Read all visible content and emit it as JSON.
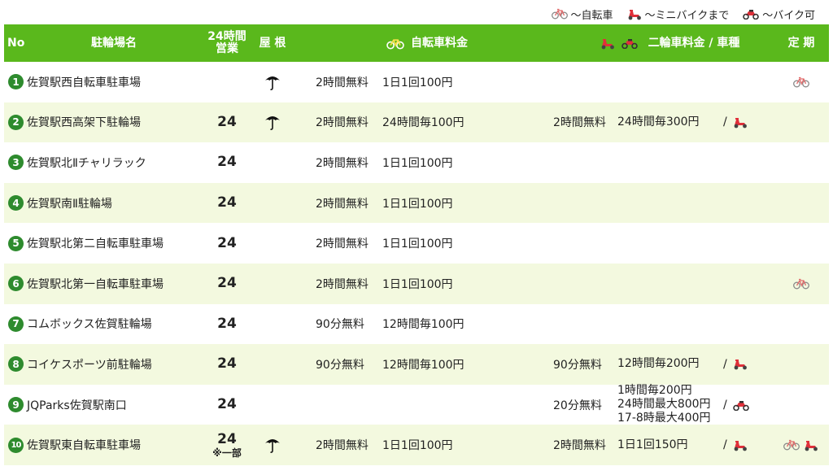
{
  "legend": {
    "bicycle": "～自転車",
    "minibike": "～ミニバイクまで",
    "bike": "～バイク可"
  },
  "header": {
    "no": "No",
    "name": "駐輪場名",
    "open24_line1": "24時間",
    "open24_line2": "営業",
    "roof": "屋 根",
    "bicycle_fee": "自転車料金",
    "twowheel_fee": "二輪車料金 / 車種",
    "teiki": "定 期"
  },
  "colors": {
    "header_bg": "#5ab81c",
    "row_shade": "#f3f9df",
    "badge": "#2e8b2e",
    "vehicle_red": "#e0303a"
  },
  "rows": [
    {
      "no": "1",
      "name": "佐賀駅西自転車駐車場",
      "open24": "",
      "open24_note": "",
      "roof": true,
      "bicycle_free": "2時間無料",
      "bicycle_fee": "1日1回100円",
      "moto_free": "",
      "moto_fee": [],
      "moto_type": "",
      "teiki": [
        "bicycle"
      ]
    },
    {
      "no": "2",
      "name": "佐賀駅西高架下駐輪場",
      "open24": "24",
      "open24_note": "",
      "roof": true,
      "bicycle_free": "2時間無料",
      "bicycle_fee": "24時間毎100円",
      "moto_free": "2時間無料",
      "moto_fee": [
        "24時間毎300円"
      ],
      "moto_type": "minibike",
      "teiki": []
    },
    {
      "no": "3",
      "name": "佐賀駅北Ⅱチャリラック",
      "open24": "24",
      "open24_note": "",
      "roof": false,
      "bicycle_free": "2時間無料",
      "bicycle_fee": "1日1回100円",
      "moto_free": "",
      "moto_fee": [],
      "moto_type": "",
      "teiki": []
    },
    {
      "no": "4",
      "name": "佐賀駅南Ⅱ駐輪場",
      "open24": "24",
      "open24_note": "",
      "roof": false,
      "bicycle_free": "2時間無料",
      "bicycle_fee": "1日1回100円",
      "moto_free": "",
      "moto_fee": [],
      "moto_type": "",
      "teiki": []
    },
    {
      "no": "5",
      "name": "佐賀駅北第二自転車駐車場",
      "open24": "24",
      "open24_note": "",
      "roof": false,
      "bicycle_free": "2時間無料",
      "bicycle_fee": "1日1回100円",
      "moto_free": "",
      "moto_fee": [],
      "moto_type": "",
      "teiki": []
    },
    {
      "no": "6",
      "name": "佐賀駅北第一自転車駐車場",
      "open24": "24",
      "open24_note": "",
      "roof": false,
      "bicycle_free": "2時間無料",
      "bicycle_fee": "1日1回100円",
      "moto_free": "",
      "moto_fee": [],
      "moto_type": "",
      "teiki": [
        "bicycle"
      ]
    },
    {
      "no": "7",
      "name": "コムボックス佐賀駐輪場",
      "open24": "24",
      "open24_note": "",
      "roof": false,
      "bicycle_free": "90分無料",
      "bicycle_fee": "12時間毎100円",
      "moto_free": "",
      "moto_fee": [],
      "moto_type": "",
      "teiki": []
    },
    {
      "no": "8",
      "name": "コイケスポーツ前駐輪場",
      "open24": "24",
      "open24_note": "",
      "roof": false,
      "bicycle_free": "90分無料",
      "bicycle_fee": "12時間毎100円",
      "moto_free": "90分無料",
      "moto_fee": [
        "12時間毎200円"
      ],
      "moto_type": "minibike",
      "teiki": []
    },
    {
      "no": "9",
      "name": "JQParks佐賀駅南口",
      "open24": "24",
      "open24_note": "",
      "roof": false,
      "bicycle_free": "",
      "bicycle_fee": "",
      "moto_free": "20分無料",
      "moto_fee": [
        "1時間毎200円",
        "24時間最大800円",
        "17-8時最大400円"
      ],
      "moto_type": "bike",
      "teiki": []
    },
    {
      "no": "10",
      "name": "佐賀駅東自転車駐車場",
      "open24": "24",
      "open24_note": "※一部",
      "roof": true,
      "bicycle_free": "2時間無料",
      "bicycle_fee": "1日1回100円",
      "moto_free": "2時間無料",
      "moto_fee": [
        "1日1回150円"
      ],
      "moto_type": "minibike",
      "teiki": [
        "bicycle",
        "minibike"
      ]
    }
  ]
}
